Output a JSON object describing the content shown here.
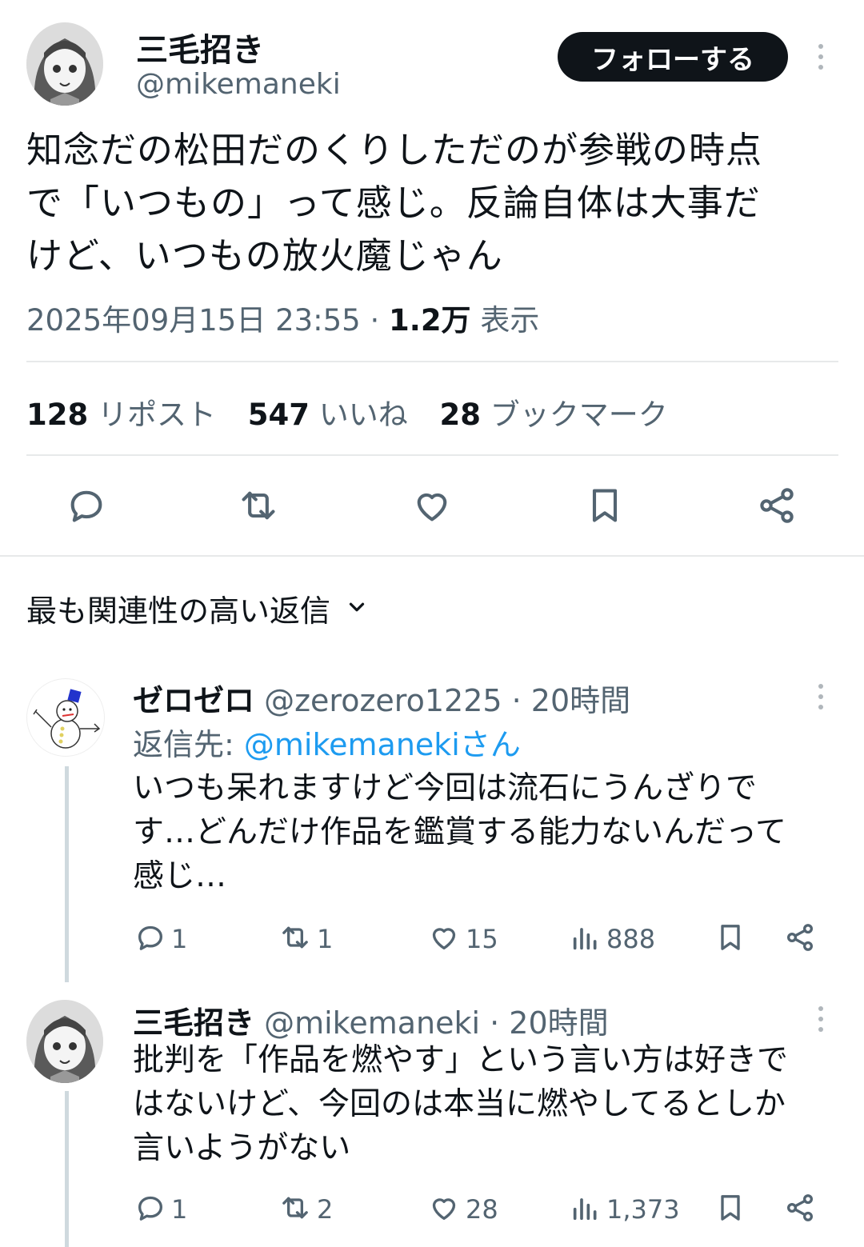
{
  "tweet": {
    "display_name": "三毛招き",
    "handle": "@mikemaneki",
    "follow_label": "フォローする",
    "text_lines": [
      "知念だの松田だのくりしただのが参戦の時点",
      "で「いつもの」って感じ。反論自体は大事だ",
      "けど、いつもの放火魔じゃん"
    ],
    "timestamp": "2025年09月15日 23:55",
    "separator": "·",
    "views_count": "1.2万",
    "views_label": "表示"
  },
  "stats": {
    "reposts_count": "128",
    "reposts_label": "リポスト",
    "likes_count": "547",
    "likes_label": "いいね",
    "bookmarks_count": "28",
    "bookmarks_label": "ブックマーク"
  },
  "actions": [
    "reply-icon",
    "repost-icon",
    "like-icon",
    "bookmark-icon",
    "share-icon"
  ],
  "sort": {
    "label": "最も関連性の高い返信"
  },
  "replies": [
    {
      "display_name": "ゼロゼロ",
      "handle": "@zerozero1225",
      "time": "· 20時間",
      "reply_to_prefix": "返信先:",
      "reply_to_handle": "@mikemanekiさん",
      "text_lines": [
        "いつも呆れますけど今回は流石にうんざりで",
        "す…どんだけ作品を鑑賞する能力ないんだって",
        "感じ…"
      ],
      "replies": "1",
      "reposts": "1",
      "likes": "15",
      "views": "888"
    },
    {
      "display_name": "三毛招き",
      "handle": "@mikemaneki",
      "time": "· 20時間",
      "text_lines": [
        "批判を「作品を燃やす」という言い方は好きで",
        "はないけど、今回のは本当に燃やしてるとしか",
        "言いようがない"
      ],
      "replies": "1",
      "reposts": "2",
      "likes": "28",
      "views": "1,373"
    }
  ],
  "colors": {
    "text": "#0f1419",
    "secondary": "#536471",
    "link": "#1d9bf0",
    "divider": "#e7e9ea"
  }
}
